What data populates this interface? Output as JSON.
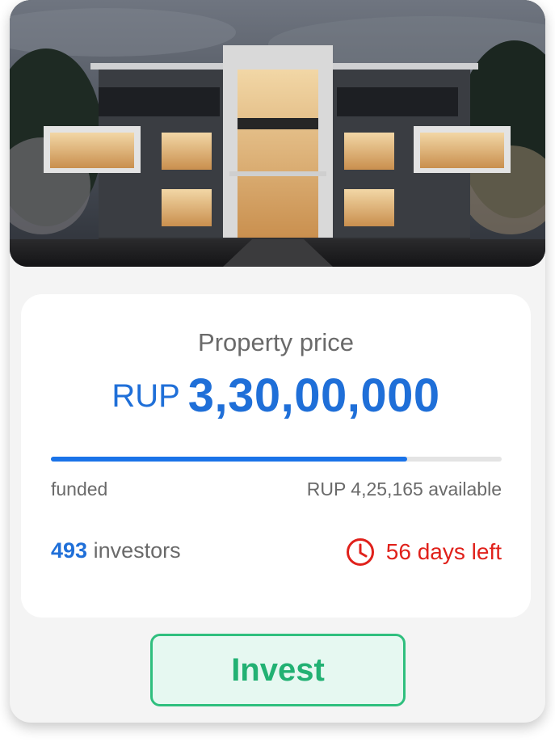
{
  "photo": {
    "alt": "Modern three-storey residence at dusk"
  },
  "price": {
    "label": "Property price",
    "currency": "RUP",
    "value": "3,30,00,000"
  },
  "funding": {
    "progress_fraction": 0.79,
    "funded_label": "funded",
    "available_text": "RUP 4,25,165 available"
  },
  "investors": {
    "count": "493",
    "suffix": "investors"
  },
  "deadline": {
    "text": "56 days left",
    "icon": "clock-icon"
  },
  "actions": {
    "invest_label": "Invest"
  },
  "colors": {
    "accent_blue": "#1a73e8",
    "deadline_red": "#e0211b",
    "invest_green": "#2fbf7e",
    "card_bg": "#f4f4f4"
  }
}
